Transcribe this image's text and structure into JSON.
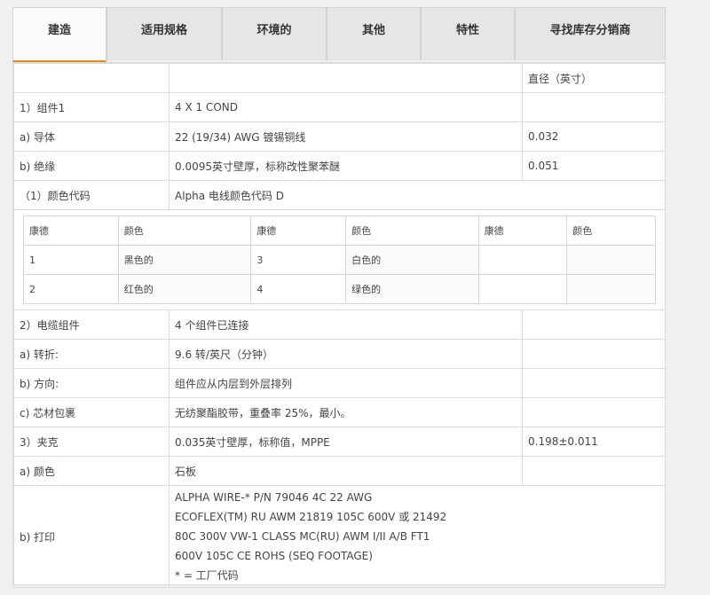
{
  "tabs": [
    {
      "label": "建造",
      "active": true
    },
    {
      "label": "适用规格",
      "active": false
    },
    {
      "label": "环境的",
      "active": false
    },
    {
      "label": "其他",
      "active": false
    },
    {
      "label": "特性",
      "active": false
    },
    {
      "label": "寻找库存分销商",
      "active": false
    }
  ],
  "accent_color": "#f08a24",
  "table": {
    "diameter_header": "直径（英寸）",
    "rows": [
      {
        "label": "1）组件1",
        "value": "4 X 1 COND",
        "diameter": ""
      },
      {
        "label": "a) 导体",
        "value": "22 (19/34) AWG 镀锡铜线",
        "diameter": "0.032"
      },
      {
        "label": "b) 绝缘",
        "value": "0.0095英寸壁厚，标称改性聚苯醚",
        "diameter": "0.051"
      },
      {
        "label": "（1）颜色代码",
        "value": "Alpha 电线颜色代码 D"
      }
    ],
    "color_code": {
      "headers": [
        "康德",
        "颜色",
        "康德",
        "颜色",
        "康德",
        "颜色"
      ],
      "rows": [
        [
          "1",
          "黑色的",
          "3",
          "白色的",
          "",
          ""
        ],
        [
          "2",
          "红色的",
          "4",
          "绿色的",
          "",
          ""
        ]
      ]
    },
    "rows2": [
      {
        "label": "2）电缆组件",
        "value": "4 个组件已连接",
        "diameter": ""
      },
      {
        "label": "a) 转折:",
        "value": "9.6 转/英尺（分钟）",
        "diameter": ""
      },
      {
        "label": "b) 方向:",
        "value": "组件应从内层到外层排列",
        "diameter": ""
      },
      {
        "label": "c) 芯材包裹",
        "value": "无纺聚酯胶带，重叠率 25%，最小。",
        "diameter": ""
      },
      {
        "label": "3）夹克",
        "value": "0.035英寸壁厚，标称值，MPPE",
        "diameter": "0.198±0.011"
      },
      {
        "label": "a) 颜色",
        "value": "石板",
        "diameter": ""
      }
    ],
    "print": {
      "label": "b) 打印",
      "lines": [
        "ALPHA WIRE-* P/N 79046 4C 22 AWG",
        "ECOFLEX(TM) RU AWM 21819 105C 600V 或 21492",
        "80C 300V VW-1 CLASS MC(RU) AWM I/II A/B FT1",
        "600V 105C CE ROHS (SEQ FOOTAGE)",
        "* = 工厂代码"
      ]
    }
  }
}
